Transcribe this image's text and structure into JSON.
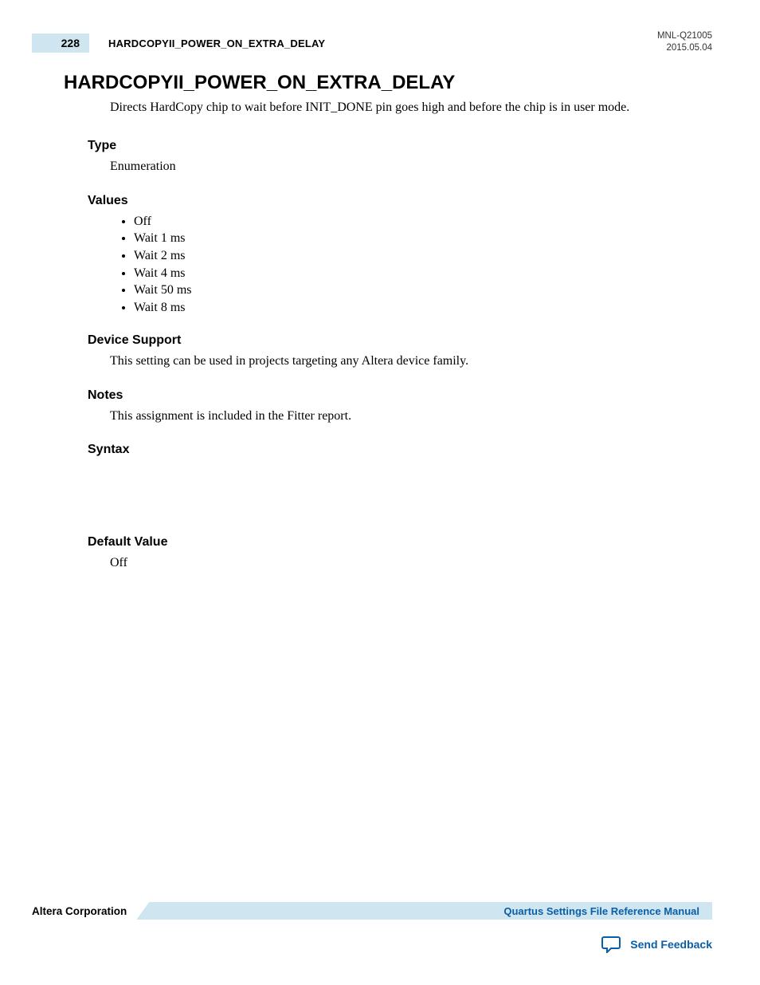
{
  "header": {
    "page_number": "228",
    "running_title": "HARDCOPYII_POWER_ON_EXTRA_DELAY",
    "doc_id": "MNL-Q21005",
    "date": "2015.05.04"
  },
  "title": "HARDCOPYII_POWER_ON_EXTRA_DELAY",
  "intro": "Directs HardCopy chip to wait before INIT_DONE pin goes high and before the chip is in user mode.",
  "sections": {
    "type": {
      "heading": "Type",
      "body": "Enumeration"
    },
    "values": {
      "heading": "Values",
      "items": [
        "Off",
        "Wait 1 ms",
        "Wait 2 ms",
        "Wait 4 ms",
        "Wait 50 ms",
        "Wait 8 ms"
      ]
    },
    "device_support": {
      "heading": "Device Support",
      "body": "This setting can be used in projects targeting any Altera device family."
    },
    "notes": {
      "heading": "Notes",
      "body": "This assignment is included in the Fitter report."
    },
    "syntax": {
      "heading": "Syntax"
    },
    "default_value": {
      "heading": "Default Value",
      "body": "Off"
    }
  },
  "footer": {
    "company": "Altera Corporation",
    "manual_link": "Quartus Settings File Reference Manual",
    "feedback": "Send Feedback"
  }
}
